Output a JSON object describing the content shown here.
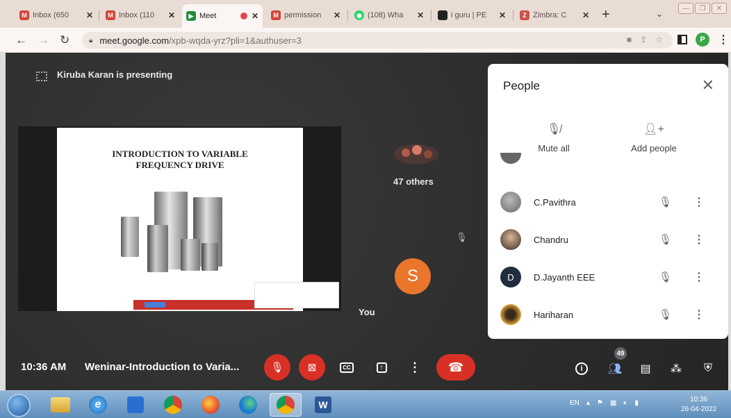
{
  "browser": {
    "tabs": [
      {
        "title": "Inbox (650",
        "icon": "gmail-icon",
        "color": "#d44638",
        "letter": "M",
        "active": false
      },
      {
        "title": "Inbox (110",
        "icon": "gmail-icon",
        "color": "#d44638",
        "letter": "M",
        "active": false
      },
      {
        "title": "Meet",
        "icon": "meet-icon",
        "color": "#1e8e3e",
        "letter": "▶",
        "active": true
      },
      {
        "title": "permission",
        "icon": "gmail-icon",
        "color": "#d44638",
        "letter": "M",
        "active": false
      },
      {
        "title": "(108) Wha",
        "icon": "whatsapp-icon",
        "color": "#25d366",
        "letter": "◉",
        "active": false
      },
      {
        "title": "i guru | PE",
        "icon": "iguru-icon",
        "color": "#222222",
        "letter": "■",
        "active": false
      },
      {
        "title": "Zimbra: C",
        "icon": "zimbra-icon",
        "color": "#c9544b",
        "letter": "Z",
        "active": false
      }
    ],
    "url_host": "meet.google.com",
    "url_path": "/xpb-wqda-yrz?pli=1&authuser=3",
    "profile_initial": "P"
  },
  "meet": {
    "presenter_text": "Kiruba Karan is presenting",
    "slide_title": "INTRODUCTION TO VARIABLE\nFREQUENCY DRIVE",
    "others_label": "47 others",
    "self_initial": "S",
    "self_label": "You",
    "clock": "10:36 AM",
    "meeting_title": "Weninar-Introduction to Varia...",
    "participants_badge": "49"
  },
  "people_panel": {
    "title": "People",
    "mute_all_label": "Mute all",
    "add_people_label": "Add people",
    "people": [
      {
        "name": "C.Pavithra",
        "avatar": "photo",
        "color": "#8a8a8a"
      },
      {
        "name": "Chandru",
        "avatar": "photo",
        "color": "#7a6a58"
      },
      {
        "name": "D.Jayanth EEE",
        "avatar": "D",
        "color": "#1f2d3d"
      },
      {
        "name": "Hariharan",
        "avatar": "photo",
        "color": "#c98a2a"
      }
    ]
  },
  "taskbar": {
    "lang": "EN",
    "time": "10:36",
    "date": "26-04-2022"
  }
}
